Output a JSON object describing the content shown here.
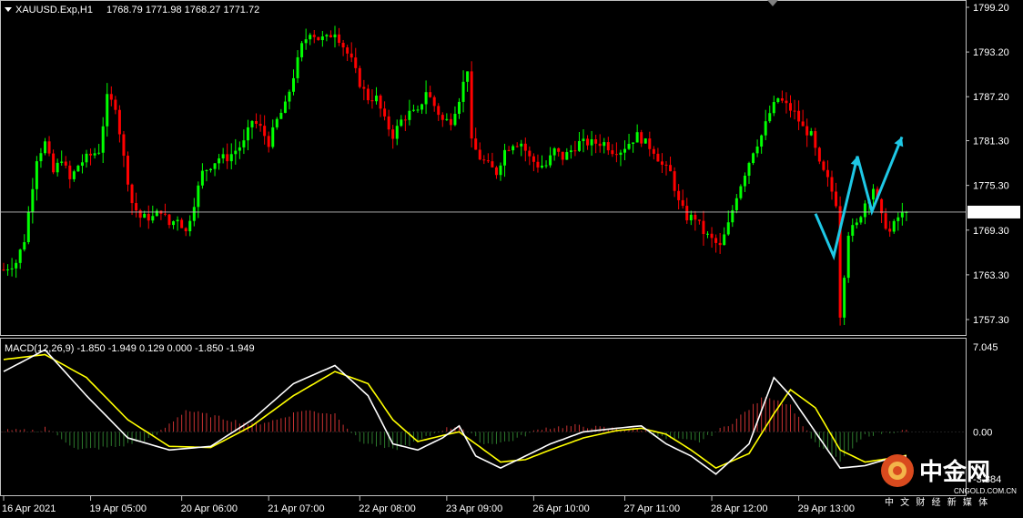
{
  "chart_data": {
    "type": "candlestick",
    "header": {
      "symbol": "XAUUSD.Exp,H1",
      "ohlc": "1768.79 1771.98 1768.27 1771.72"
    },
    "price_axis": {
      "ticks": [
        "1799.20",
        "1793.20",
        "1787.20",
        "1781.30",
        "1775.30",
        "1769.30",
        "1763.30",
        "1757.30"
      ],
      "range": [
        1755.8,
        1800.2
      ],
      "current_price": "1771.72"
    },
    "time_labels": [
      "16 Apr 2021",
      "19 Apr 05:00",
      "20 Apr 06:00",
      "21 Apr 07:00",
      "22 Apr 08:00",
      "23 Apr 09:00",
      "26 Apr 10:00",
      "27 Apr 11:00",
      "28 Apr 12:00",
      "29 Apr 13:00"
    ],
    "price_path": [
      [
        0,
        1764
      ],
      [
        3,
        1765
      ],
      [
        5,
        1768
      ],
      [
        8,
        1779
      ],
      [
        10,
        1781
      ],
      [
        12,
        1777
      ],
      [
        14,
        1779
      ],
      [
        16,
        1776
      ],
      [
        18,
        1778
      ],
      [
        20,
        1779
      ],
      [
        23,
        1780
      ],
      [
        25,
        1787
      ],
      [
        27,
        1786
      ],
      [
        29,
        1779
      ],
      [
        31,
        1773
      ],
      [
        33,
        1771
      ],
      [
        36,
        1771
      ],
      [
        38,
        1772
      ],
      [
        40,
        1770
      ],
      [
        42,
        1771
      ],
      [
        44,
        1769
      ],
      [
        46,
        1773
      ],
      [
        48,
        1777
      ],
      [
        50,
        1778
      ],
      [
        52,
        1779
      ],
      [
        54,
        1779
      ],
      [
        56,
        1780
      ],
      [
        58,
        1781
      ],
      [
        60,
        1784
      ],
      [
        62,
        1783
      ],
      [
        64,
        1781
      ],
      [
        66,
        1784
      ],
      [
        68,
        1786
      ],
      [
        70,
        1790
      ],
      [
        72,
        1794
      ],
      [
        74,
        1796
      ],
      [
        76,
        1795
      ],
      [
        78,
        1795
      ],
      [
        80,
        1796
      ],
      [
        82,
        1794
      ],
      [
        84,
        1792
      ],
      [
        86,
        1789
      ],
      [
        88,
        1787
      ],
      [
        90,
        1787
      ],
      [
        92,
        1784
      ],
      [
        94,
        1782
      ],
      [
        96,
        1784
      ],
      [
        98,
        1785
      ],
      [
        100,
        1785
      ],
      [
        102,
        1788
      ],
      [
        104,
        1786
      ],
      [
        106,
        1784
      ],
      [
        108,
        1784
      ],
      [
        110,
        1787
      ],
      [
        112,
        1791
      ],
      [
        113,
        1781
      ],
      [
        115,
        1779
      ],
      [
        117,
        1778
      ],
      [
        119,
        1777
      ],
      [
        121,
        1780
      ],
      [
        123,
        1781
      ],
      [
        125,
        1781
      ],
      [
        127,
        1779
      ],
      [
        129,
        1778
      ],
      [
        131,
        1778
      ],
      [
        133,
        1780
      ],
      [
        135,
        1779
      ],
      [
        137,
        1780
      ],
      [
        139,
        1781
      ],
      [
        141,
        1781
      ],
      [
        143,
        1781
      ],
      [
        145,
        1781
      ],
      [
        147,
        1780
      ],
      [
        149,
        1780
      ],
      [
        151,
        1781
      ],
      [
        153,
        1782
      ],
      [
        155,
        1781
      ],
      [
        157,
        1780
      ],
      [
        159,
        1778
      ],
      [
        161,
        1777
      ],
      [
        163,
        1773
      ],
      [
        165,
        1771
      ],
      [
        167,
        1771
      ],
      [
        169,
        1769
      ],
      [
        171,
        1768
      ],
      [
        173,
        1767
      ],
      [
        175,
        1770
      ],
      [
        177,
        1774
      ],
      [
        179,
        1777
      ],
      [
        181,
        1780
      ],
      [
        183,
        1782
      ],
      [
        185,
        1785
      ],
      [
        187,
        1787
      ],
      [
        189,
        1786
      ],
      [
        191,
        1785
      ],
      [
        193,
        1783
      ],
      [
        195,
        1782
      ],
      [
        197,
        1778
      ],
      [
        199,
        1776
      ],
      [
        201,
        1773
      ],
      [
        202,
        1758
      ],
      [
        204,
        1769
      ],
      [
        206,
        1770
      ],
      [
        208,
        1773
      ],
      [
        210,
        1775
      ],
      [
        212,
        1771
      ],
      [
        214,
        1769
      ],
      [
        216,
        1771
      ],
      [
        218,
        1771.72
      ]
    ],
    "forecast_arrow": [
      [
        1768,
        1771.5
      ],
      [
        1767,
        1765.8
      ],
      [
        1778.5,
        1779.2
      ],
      [
        1773.2,
        1771.8
      ],
      [
        1781.3,
        1781.8
      ]
    ],
    "macd": {
      "label": "MACD(12,26,9) -1.850 -1.949 0.129 0.000 -1.850 -1.949",
      "ticks": [
        "7.045",
        "0.00",
        "-3.884"
      ],
      "range": [
        -4.8,
        7.045
      ],
      "main": [
        [
          0,
          5
        ],
        [
          10,
          6.8
        ],
        [
          20,
          3
        ],
        [
          30,
          -0.5
        ],
        [
          40,
          -1.5
        ],
        [
          50,
          -1.2
        ],
        [
          60,
          1
        ],
        [
          70,
          4
        ],
        [
          80,
          5.5
        ],
        [
          88,
          3
        ],
        [
          94,
          -1
        ],
        [
          100,
          -1.5
        ],
        [
          106,
          -0.5
        ],
        [
          110,
          0.5
        ],
        [
          114,
          -2
        ],
        [
          120,
          -3
        ],
        [
          126,
          -2
        ],
        [
          132,
          -1
        ],
        [
          140,
          0
        ],
        [
          148,
          0.3
        ],
        [
          154,
          0.5
        ],
        [
          160,
          -1
        ],
        [
          166,
          -2
        ],
        [
          172,
          -3.5
        ],
        [
          180,
          -1
        ],
        [
          186,
          4.5
        ],
        [
          190,
          3
        ],
        [
          196,
          0
        ],
        [
          202,
          -3
        ],
        [
          208,
          -2.8
        ],
        [
          214,
          -2.2
        ],
        [
          218,
          -2
        ]
      ],
      "signal": [
        [
          0,
          6
        ],
        [
          10,
          6.4
        ],
        [
          20,
          4.5
        ],
        [
          30,
          1
        ],
        [
          40,
          -1.2
        ],
        [
          50,
          -1.3
        ],
        [
          60,
          0.5
        ],
        [
          70,
          3
        ],
        [
          80,
          5
        ],
        [
          88,
          4
        ],
        [
          94,
          1
        ],
        [
          100,
          -0.8
        ],
        [
          106,
          -0.3
        ],
        [
          110,
          0
        ],
        [
          114,
          -1
        ],
        [
          120,
          -2.5
        ],
        [
          126,
          -2.3
        ],
        [
          132,
          -1.5
        ],
        [
          140,
          -0.5
        ],
        [
          148,
          0.1
        ],
        [
          154,
          0.3
        ],
        [
          160,
          -0.2
        ],
        [
          166,
          -1.5
        ],
        [
          172,
          -3
        ],
        [
          180,
          -1.8
        ],
        [
          186,
          1.5
        ],
        [
          190,
          3.5
        ],
        [
          196,
          2
        ],
        [
          202,
          -1.5
        ],
        [
          208,
          -2.5
        ],
        [
          214,
          -2.2
        ],
        [
          218,
          -1.95
        ]
      ],
      "histogram": [
        [
          10,
          0.4
        ],
        [
          18,
          -1.5
        ],
        [
          28,
          -1.2
        ],
        [
          36,
          -0.5
        ],
        [
          44,
          1.8
        ],
        [
          52,
          1.2
        ],
        [
          60,
          0.6
        ],
        [
          66,
          1.0
        ],
        [
          72,
          1.8
        ],
        [
          80,
          1.5
        ],
        [
          86,
          -0.8
        ],
        [
          94,
          -1.5
        ],
        [
          100,
          -0.8
        ],
        [
          106,
          0.2
        ],
        [
          110,
          0.5
        ],
        [
          116,
          -1.0
        ],
        [
          122,
          -0.8
        ],
        [
          130,
          0.3
        ],
        [
          138,
          0.5
        ],
        [
          146,
          0.3
        ],
        [
          154,
          0.2
        ],
        [
          160,
          -0.6
        ],
        [
          168,
          -0.8
        ],
        [
          176,
          0.8
        ],
        [
          184,
          3.0
        ],
        [
          190,
          2.2
        ],
        [
          196,
          -1.0
        ],
        [
          202,
          -2.4
        ],
        [
          208,
          -0.3
        ],
        [
          214,
          0
        ],
        [
          218,
          0.1
        ]
      ]
    },
    "watermark": {
      "brand_cn": "中金网",
      "brand_en": "CNGOLD.COM.CN",
      "slogan_cn": "中 文 财 经 新 媒 体"
    },
    "colors": {
      "up_candle": "#00ff00",
      "down_candle": "#ff0000",
      "macd_main": "#ffffff",
      "macd_signal": "#ffff00",
      "forecast": "#1ec8e6",
      "grid": "#c0c0c0"
    }
  }
}
